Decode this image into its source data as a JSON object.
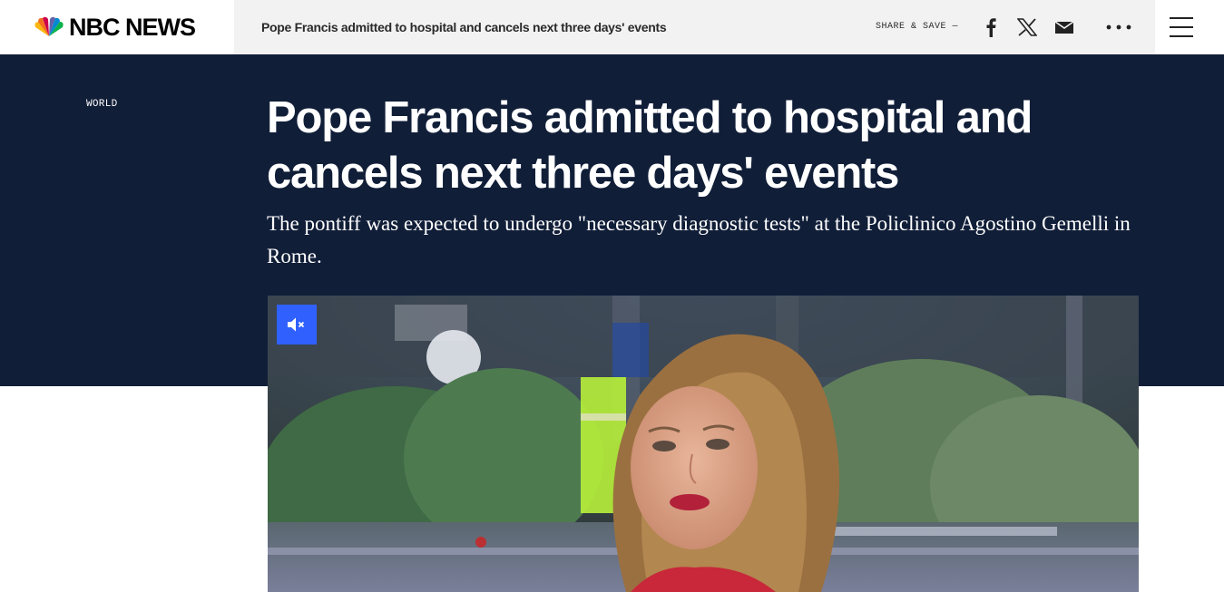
{
  "header": {
    "logo_text": "NBC NEWS",
    "strip_title": "Pope Francis admitted to hospital and cancels next three days' events",
    "share_label": "SHARE & SAVE —",
    "icons": [
      "facebook-icon",
      "x-icon",
      "mail-icon",
      "more-icon",
      "menu-icon"
    ]
  },
  "article": {
    "section": "WORLD",
    "headline": "Pope Francis admitted to hospital and cancels next three days' events",
    "dek": "The pontiff was expected to undergo \"necessary diagnostic tests\" at the Policlinico Agostino Gemelli in Rome."
  },
  "video": {
    "mute_icon": "volume-muted-icon",
    "mute_color": "#3061ff"
  },
  "colors": {
    "hero_bg": "#111e38",
    "strip_bg": "#f2f2f2"
  }
}
